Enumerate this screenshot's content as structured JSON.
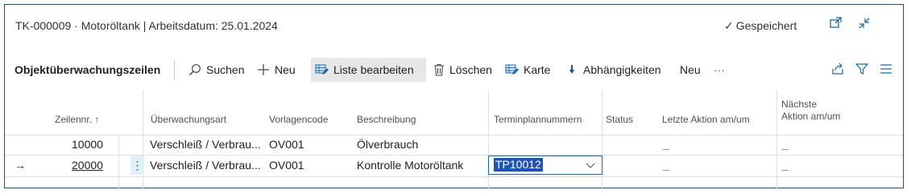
{
  "window": {
    "title": "TK-000009 · Motoröltank | Arbeitsdatum: 25.01.2024",
    "saved_status": "Gespeichert"
  },
  "actionbar": {
    "group_title": "Objektüberwachungszeilen",
    "search_label": "Suchen",
    "new_label": "Neu",
    "edit_list_label": "Liste bearbeiten",
    "delete_label": "Löschen",
    "card_label": "Karte",
    "dependencies_label": "Abhängigkeiten",
    "new2_label": "Neu",
    "more_label": "···"
  },
  "grid": {
    "columns": {
      "line_no": "Zeilennr. ↑",
      "monitoring_type": "Überwachungsart",
      "template_code": "Vorlagencode",
      "description": "Beschreibung",
      "schedule_numbers": "Terminplannummern",
      "status": "Status",
      "last_action": "Letzte Aktion am/um",
      "next_action": "Nächste Aktion am/um"
    },
    "rows": [
      {
        "line_no": "10000",
        "monitoring_type": "Verschleiß / Verbrau...",
        "template_code": "OV001",
        "description": "Ölverbrauch",
        "schedule_numbers": "",
        "status": "",
        "last_action": "_",
        "next_action": "_"
      },
      {
        "indicator": "→",
        "line_no": "20000",
        "monitoring_type": "Verschleiß / Verbrau...",
        "template_code": "OV001",
        "description": "Kontrolle Motoröltank",
        "schedule_numbers": "TP10012",
        "status": "",
        "last_action": "_",
        "next_action": "_"
      }
    ]
  }
}
